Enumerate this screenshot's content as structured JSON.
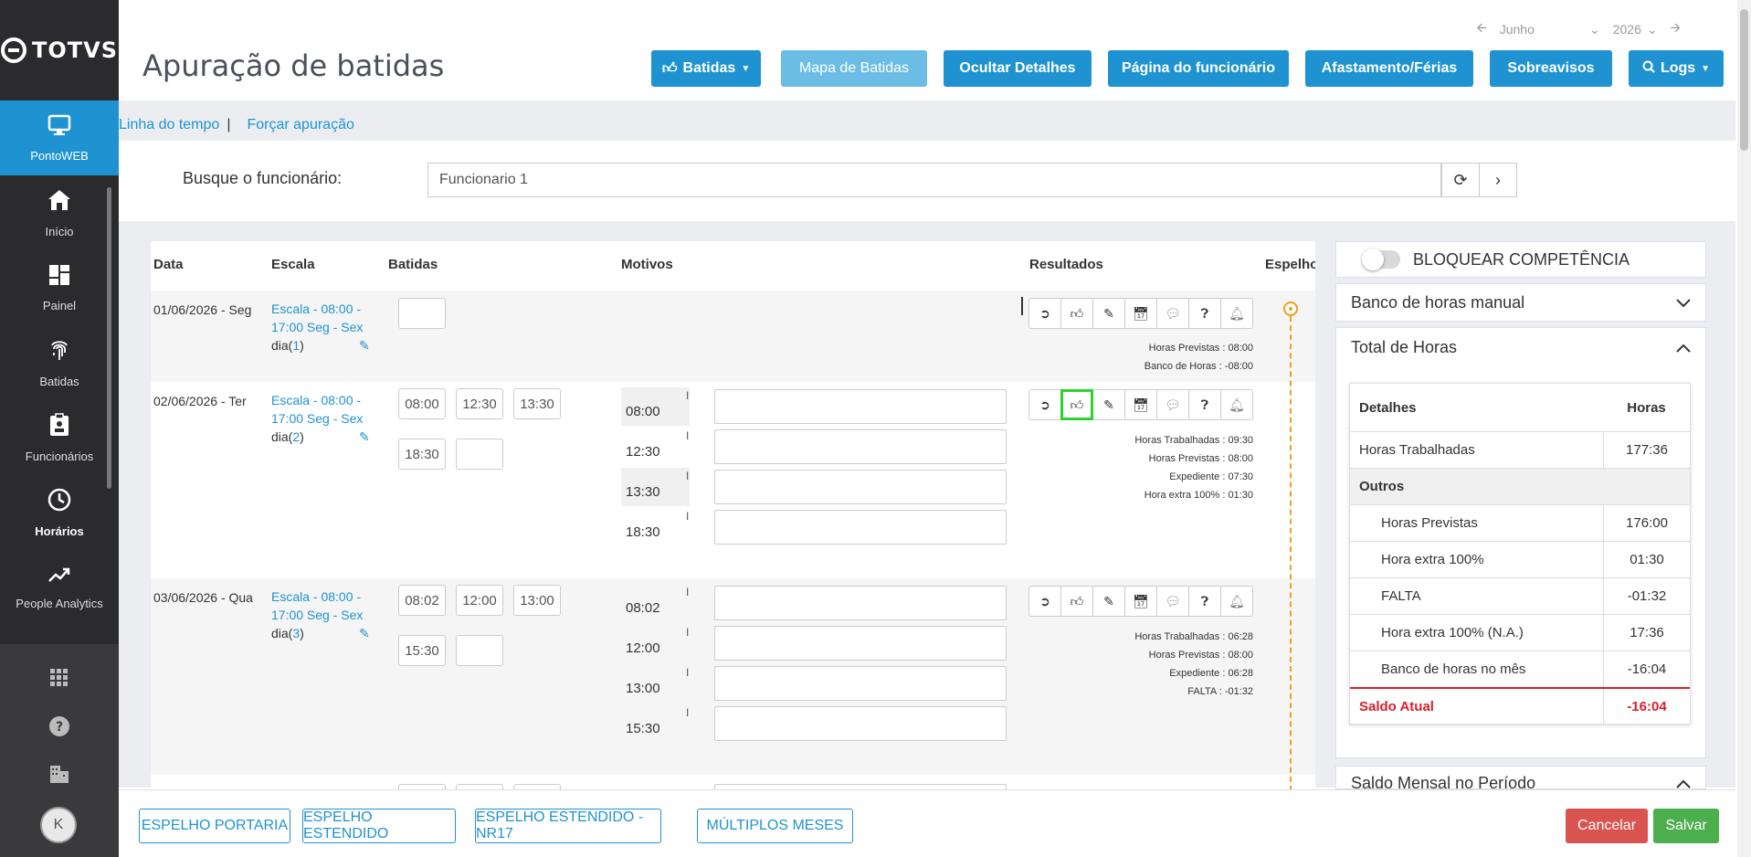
{
  "brand": "TOTVS",
  "sidebar": {
    "items": [
      {
        "label": "PontoWEB",
        "icon": "monitor-icon"
      },
      {
        "label": "Início",
        "icon": "home-icon"
      },
      {
        "label": "Painel",
        "icon": "dashboard-icon"
      },
      {
        "label": "Batidas",
        "icon": "fingerprint-icon"
      },
      {
        "label": "Funcionários",
        "icon": "badge-icon"
      },
      {
        "label": "Horários",
        "icon": "clock-icon"
      },
      {
        "label": "People Analytics",
        "icon": "trend-icon"
      }
    ],
    "avatar": "K"
  },
  "header": {
    "title": "Apuração de batidas",
    "month": "Junho",
    "year": "2026",
    "buttons": {
      "batidas": "Batidas",
      "mapa": "Mapa de Batidas",
      "ocultar": "Ocultar Detalhes",
      "pagina": "Página do funcionário",
      "afastamento": "Afastamento/Férias",
      "sobreavisos": "Sobreavisos",
      "logs": "Logs"
    }
  },
  "links": {
    "timeline": "Linha do tempo",
    "separator": "|",
    "force": "Forçar apuração"
  },
  "search": {
    "label": "Busque o funcionário:",
    "value": "Funcionario 1"
  },
  "table": {
    "headers": {
      "data": "Data",
      "escala": "Escala",
      "batidas": "Batidas",
      "motivos": "Motivos",
      "resultados": "Resultados",
      "espelho": "Espelho"
    },
    "rows": [
      {
        "date": "01/06/2026 - Seg",
        "escala": "Escala - 08:00 - 17:00 Seg - Sex",
        "dia_label": "dia(",
        "dia_num": "1",
        "dia_close": ")",
        "punches": [
          ""
        ],
        "motivos": [],
        "results": [
          "Horas Previstas : 08:00",
          "Banco de Horas : -08:00"
        ]
      },
      {
        "date": "02/06/2026 - Ter",
        "escala": "Escala - 08:00 - 17:00 Seg - Sex",
        "dia_label": "dia(",
        "dia_num": "2",
        "dia_close": ")",
        "punches": [
          "08:00",
          "12:30",
          "13:30",
          "18:30",
          ""
        ],
        "motivos": [
          "08:00",
          "12:30",
          "13:30",
          "18:30"
        ],
        "results": [
          "Horas Trabalhadas : 09:30",
          "Horas Previstas : 08:00",
          "Expediente : 07:30",
          "Hora extra 100% : 01:30"
        ]
      },
      {
        "date": "03/06/2026 - Qua",
        "escala": "Escala - 08:00 - 17:00 Seg - Sex",
        "dia_label": "dia(",
        "dia_num": "3",
        "dia_close": ")",
        "punches": [
          "08:02",
          "12:00",
          "13:00",
          "15:30",
          ""
        ],
        "motivos": [
          "08:02",
          "12:00",
          "13:00",
          "15:30"
        ],
        "results": [
          "Horas Trabalhadas : 06:28",
          "Horas Previstas : 08:00",
          "Expediente : 06:28",
          "FALTA : -01:32"
        ]
      }
    ]
  },
  "right_panel": {
    "bloquear": "BLOQUEAR COMPETÊNCIA",
    "banco_manual": "Banco de horas manual",
    "total_horas": "Total de Horas",
    "saldo_mensal": "Saldo Mensal no Período",
    "totals": {
      "headers": [
        "Detalhes",
        "Horas"
      ],
      "rows": [
        {
          "k": "Horas Trabalhadas",
          "v": "177:36"
        },
        {
          "k": "Outros",
          "v": ""
        },
        {
          "k": "Horas Previstas",
          "v": "176:00"
        },
        {
          "k": "Hora extra 100%",
          "v": "01:30"
        },
        {
          "k": "FALTA",
          "v": "-01:32"
        },
        {
          "k": "Hora extra 100% (N.A.)",
          "v": "17:36"
        },
        {
          "k": "Banco de horas no mês",
          "v": "-16:04"
        },
        {
          "k": "Saldo Atual",
          "v": "-16:04"
        }
      ]
    }
  },
  "footer": {
    "espelho_portaria": "ESPELHO PORTARIA",
    "espelho_estendido": "ESPELHO ESTENDIDO",
    "espelho_nr17": "ESPELHO ESTENDIDO - NR17",
    "multiplos": "MÚLTIPLOS MESES",
    "cancelar": "Cancelar",
    "salvar": "Salvar"
  },
  "colors": {
    "primary": "#1f93d1",
    "sidebar": "#2b2b2e",
    "highlight": "#2ed22e",
    "danger": "#d9534f",
    "success": "#4cae4c",
    "espelho": "#f0a020"
  }
}
